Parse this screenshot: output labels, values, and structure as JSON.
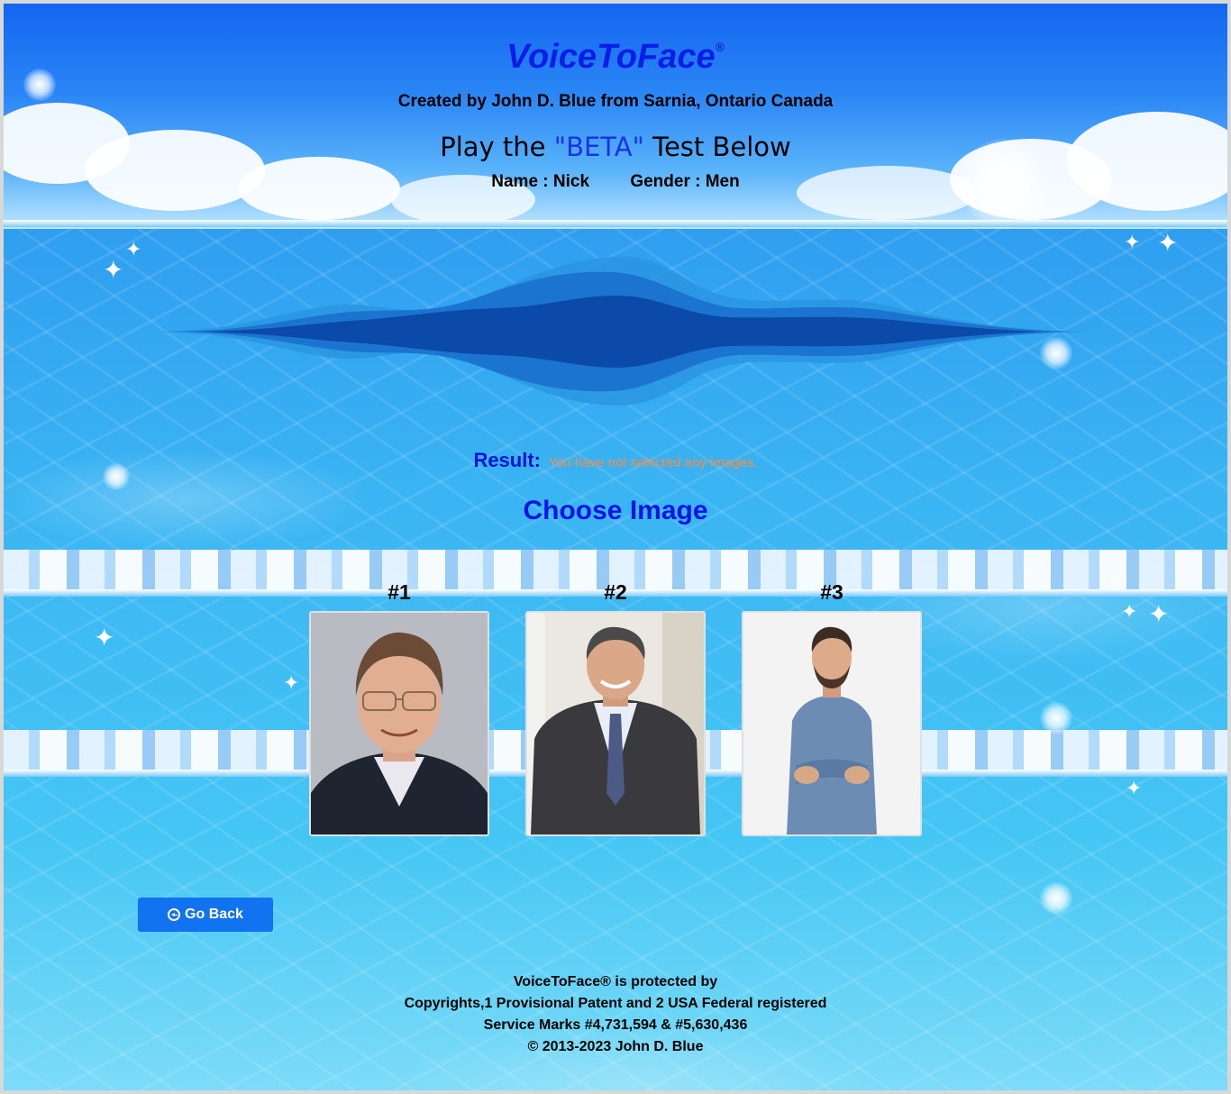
{
  "header": {
    "title": "VoiceToFace",
    "title_mark": "®",
    "creator": "Created by John D. Blue from Sarnia, Ontario Canada",
    "play_prefix": "Play the",
    "play_beta": "\"BETA\"",
    "play_suffix": "Test Below",
    "name_label": "Name : Nick",
    "gender_label": "Gender : Men"
  },
  "result": {
    "label": "Result:",
    "message": "You have not selected any images."
  },
  "choose": {
    "heading": "Choose Image",
    "cards": [
      {
        "number": "#1"
      },
      {
        "number": "#2"
      },
      {
        "number": "#3"
      }
    ]
  },
  "actions": {
    "go_back_label": "Go Back"
  },
  "footer": {
    "line1": "VoiceToFace® is protected by",
    "line2": "Copyrights,1 Provisional Patent and 2 USA Federal registered",
    "line3": "Service Marks #4,731,594 & #5,630,436",
    "line4": "© 2013-2023 John D. Blue"
  },
  "colors": {
    "title": "#0a1ee6",
    "result_label": "#0a14d6",
    "result_message": "#ff8a3d",
    "button": "#1273f0",
    "wave_dark": "#0b4fb0",
    "wave_mid": "#1a6fd0",
    "wave_light": "#2a8fe0"
  }
}
